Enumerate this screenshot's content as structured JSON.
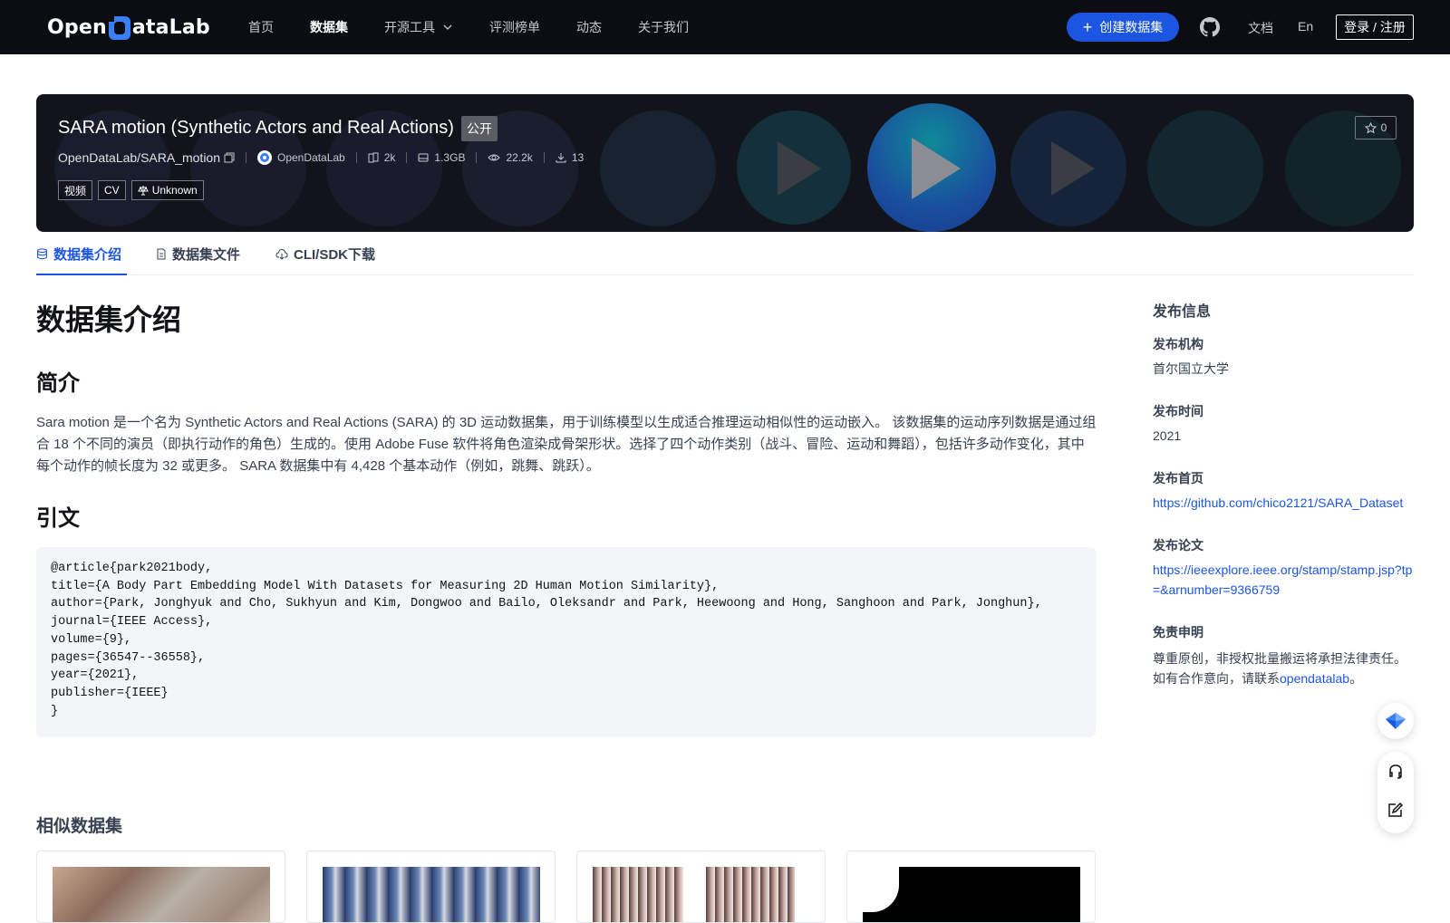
{
  "nav": {
    "logo_left": "Open",
    "logo_right": "ataLab",
    "items": [
      {
        "label": "首页"
      },
      {
        "label": "数据集"
      },
      {
        "label": "开源工具"
      },
      {
        "label": "评测榜单"
      },
      {
        "label": "动态"
      },
      {
        "label": "关于我们"
      }
    ],
    "create_label": "创建数据集",
    "docs_label": "文档",
    "lang_label": "En",
    "login_label": "登录 / 注册"
  },
  "dataset": {
    "title": "SARA motion (Synthetic Actors and Real Actions)",
    "visibility": "公开",
    "repo": "OpenDataLab/SARA_motion",
    "publisher": "OpenDataLab",
    "file_count": "2k",
    "size": "1.3GB",
    "views": "22.2k",
    "downloads": "13",
    "tags": [
      "视频",
      "CV",
      "Unknown"
    ],
    "stars": "0"
  },
  "tabs": [
    {
      "label": "数据集介绍"
    },
    {
      "label": "数据集文件"
    },
    {
      "label": "CLI/SDK下载"
    }
  ],
  "content": {
    "heading": "数据集介绍",
    "intro_heading": "简介",
    "intro_text": "Sara motion 是一个名为 Synthetic Actors and Real Actions (SARA) 的 3D 运动数据集，用于训练模型以生成适合推理运动相似性的运动嵌入。 该数据集的运动序列数据是通过组合 18 个不同的演员（即执行动作的角色）生成的。使用 Adobe Fuse 软件将角色渲染成骨架形状。选择了四个动作类别（战斗、冒险、运动和舞蹈），包括许多动作变化，其中每个动作的帧长度为 32 或更多。 SARA 数据集中有 4,428 个基本动作（例如，跳舞、跳跃）。",
    "citation_heading": "引文",
    "citation": "@article{park2021body,\ntitle={A Body Part Embedding Model With Datasets for Measuring 2D Human Motion Similarity},\nauthor={Park, Jonghyuk and Cho, Sukhyun and Kim, Dongwoo and Bailo, Oleksandr and Park, Heewoong and Hong, Sanghoon and Park, Jonghun},\njournal={IEEE Access},\nvolume={9},\npages={36547--36558},\nyear={2021},\npublisher={IEEE}\n}",
    "similar_heading": "相似数据集"
  },
  "sidebar": {
    "title": "发布信息",
    "org_label": "发布机构",
    "org_value": "首尔国立大学",
    "time_label": "发布时间",
    "time_value": "2021",
    "home_label": "发布首页",
    "home_value": "https://github.com/chico2121/SARA_Dataset",
    "paper_label": "发布论文",
    "paper_value": "https://ieeexplore.ieee.org/stamp/stamp.jsp?tp=&arnumber=9366759",
    "disclaimer_label": "免责申明",
    "disclaimer_text": "尊重原创，非授权批量搬运将承担法律责任。如有合作意向，请联系",
    "disclaimer_link": "opendatalab",
    "disclaimer_end": "。"
  },
  "colors": {
    "nav_bg": "#0b0d13",
    "accent": "#1d55e3",
    "banner_bg": "#11141b"
  }
}
